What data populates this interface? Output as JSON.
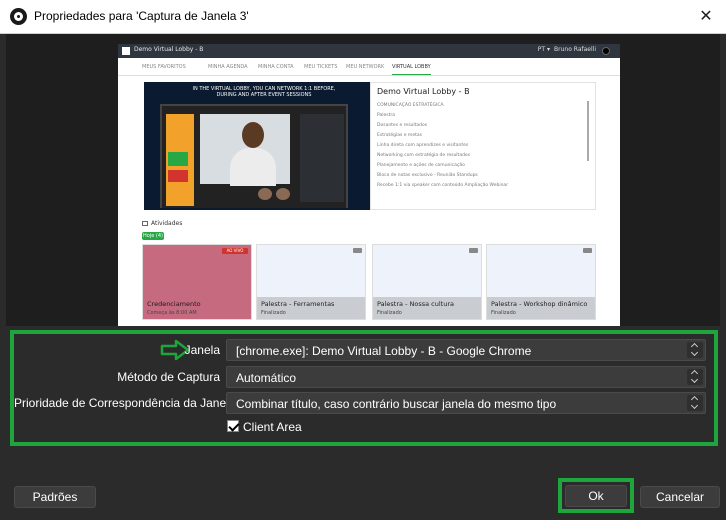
{
  "window": {
    "title": "Propriedades para 'Captura de Janela 3'",
    "close_glyph": "✕"
  },
  "preview": {
    "brand": "Demo Virtual Lobby - B",
    "lang": "PT ▾",
    "user": "Bruno Rafaelli",
    "nav": [
      "MEUS FAVORITOS",
      "MINHA AGENDA",
      "MINHA CONTA",
      "MEU TICKETS",
      "MEU NETWORK",
      "VIRTUAL LOBBY"
    ],
    "video_headline": "IN THE VIRTUAL LOBBY, YOU CAN NETWORK 1:1 BEFORE, DURING AND AFTER EVENT SESSIONS",
    "panel_title": "Demo Virtual Lobby - B",
    "panel_items": [
      "COMUNICAÇÃO ESTRATÉGICA",
      "Palestra",
      "Dosantes e resultados",
      "Estratégias e metas",
      "Linha direta com aprendizes e visitantes",
      "Networking com estratégia de resultados",
      "Planejamento e ações de comunicação",
      "Bloco de notas exclusivo - Reunião Standups",
      "Recebe 1:1 via speaker com conteúdo Ampliação Webinar"
    ],
    "activities_label": "Atividades",
    "today_label": "Hoje (4)",
    "cards": [
      {
        "title": "Credenciamento",
        "subtitle": "Começa às 8:00 AM",
        "badge": "AO VIVO"
      },
      {
        "title": "Palestra - Ferramentas",
        "subtitle": "Finalizado"
      },
      {
        "title": "Palestra - Nossa cultura",
        "subtitle": "Finalizado"
      },
      {
        "title": "Palestra - Workshop dinâmico",
        "subtitle": "Finalizado"
      }
    ]
  },
  "properties": {
    "window_label": "Janela",
    "window_value": "[chrome.exe]: Demo Virtual Lobby - B - Google Chrome",
    "capture_method_label": "Método de Captura",
    "capture_method_value": "Automático",
    "match_priority_label": "Prioridade de Correspondência da Janela",
    "match_priority_value": "Combinar título, caso contrário buscar janela do mesmo tipo",
    "client_area_label": "Client Area",
    "client_area_checked": true
  },
  "buttons": {
    "defaults": "Padrões",
    "ok": "Ok",
    "cancel": "Cancelar"
  },
  "colors": {
    "highlight": "#1ea53c",
    "background": "#2b2b2b",
    "control": "#3c3c3c"
  }
}
